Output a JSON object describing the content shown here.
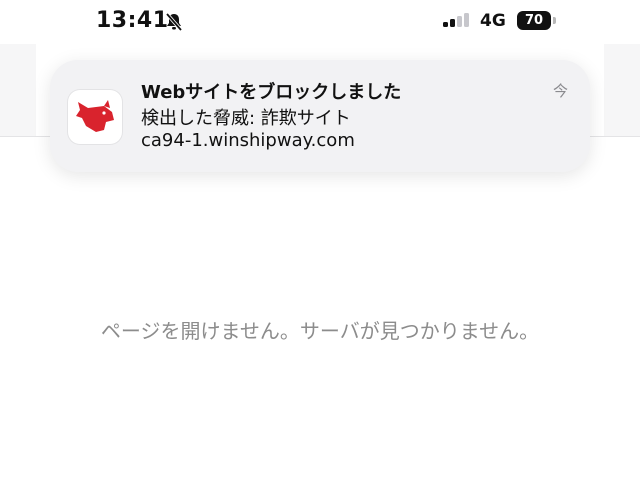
{
  "status_bar": {
    "time": "13:41",
    "network": "4G",
    "battery": "70",
    "icons": [
      "bell-slash-icon",
      "signal-icon"
    ]
  },
  "notification": {
    "title": "Webサイトをブロックしました",
    "line1": "検出した脅威: 詐欺サイト",
    "line2": "ca94-1.winshipway.com",
    "time": "今",
    "app_icon": "red-fox-icon",
    "accent_color": "#d9232d"
  },
  "page": {
    "error_message": "ページを開けません。サーバが見つかりません。"
  }
}
